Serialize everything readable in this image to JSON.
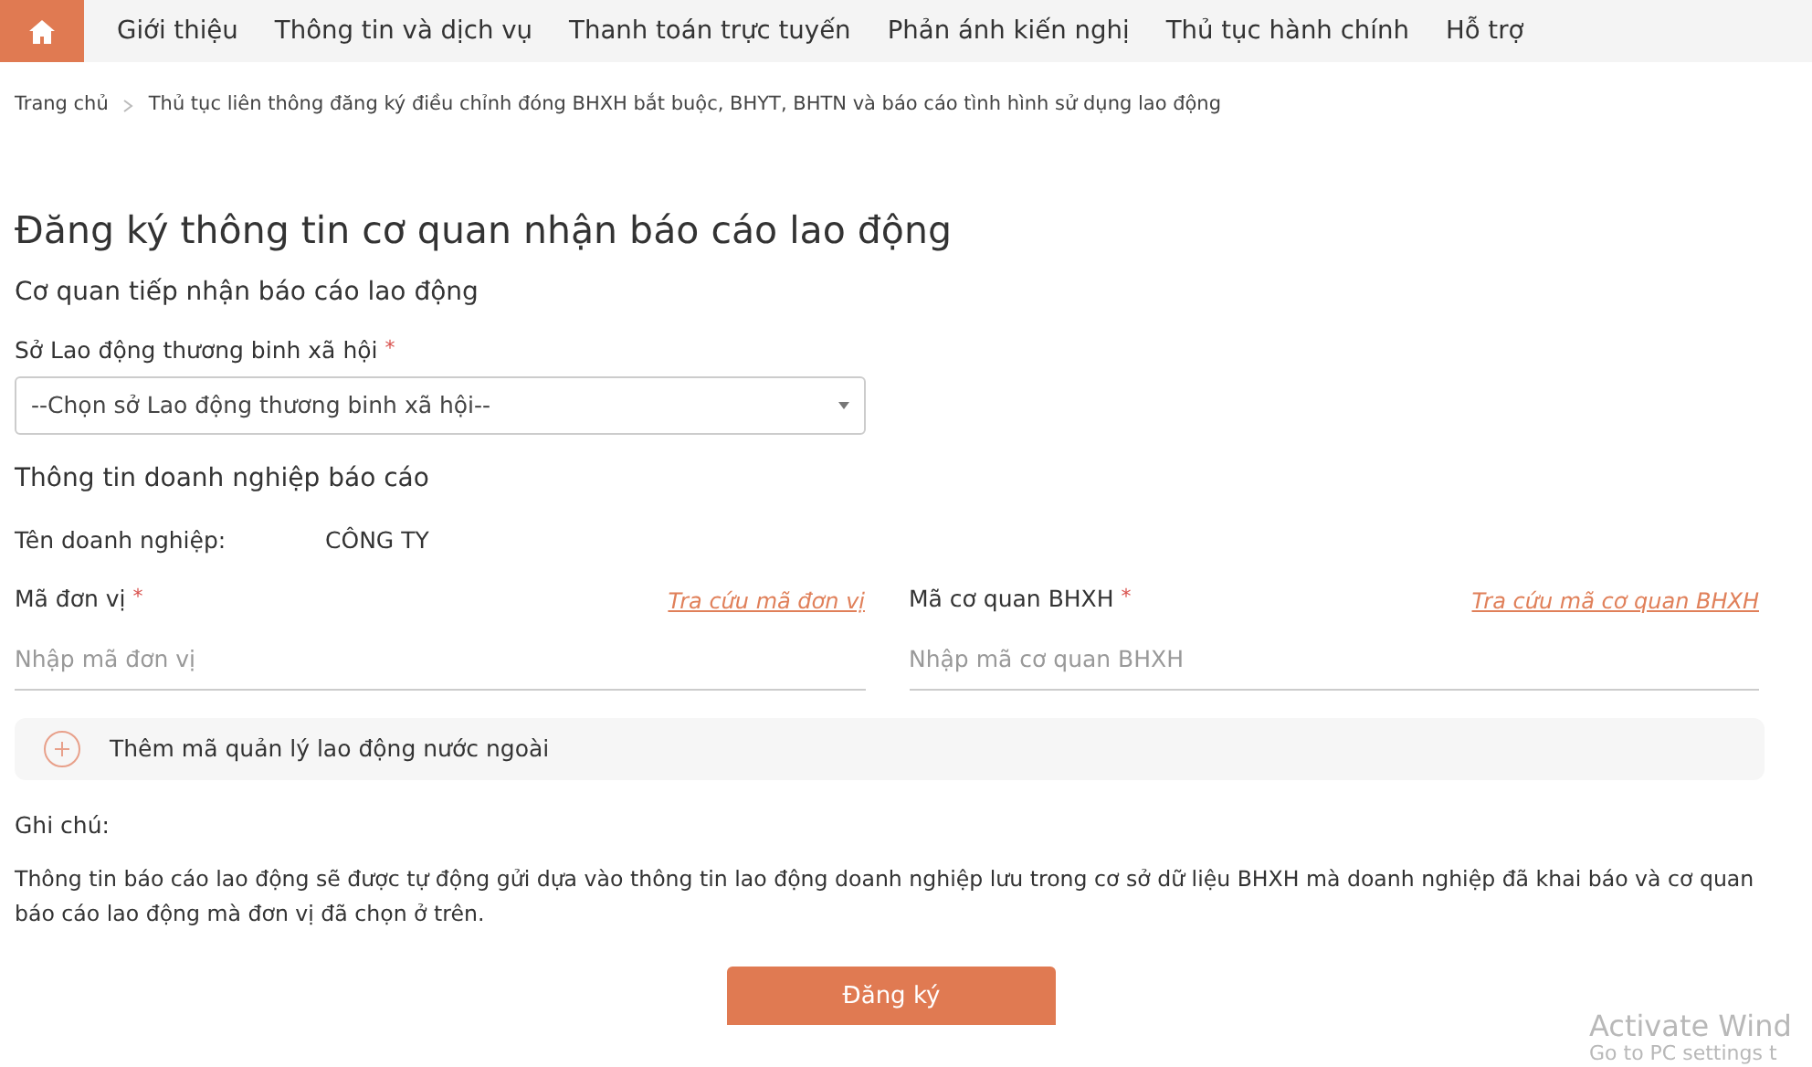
{
  "nav": {
    "items": [
      {
        "label": "Giới thiệu"
      },
      {
        "label": "Thông tin và dịch vụ"
      },
      {
        "label": "Thanh toán trực tuyến"
      },
      {
        "label": "Phản ánh kiến nghị"
      },
      {
        "label": "Thủ tục hành chính"
      },
      {
        "label": "Hỗ trợ"
      }
    ]
  },
  "breadcrumb": [
    {
      "label": "Trang chủ"
    },
    {
      "label": "Thủ tục liên thông đăng ký điều chỉnh đóng BHXH bắt buộc, BHYT, BHTN và báo cáo tình hình sử dụng lao động"
    }
  ],
  "page_title": "Đăng ký thông tin cơ quan nhận báo cáo lao động",
  "section_1": {
    "heading": "Cơ quan tiếp nhận báo cáo lao động",
    "select_label": "Sở Lao động thương binh xã hội",
    "required_mark": "*",
    "select_value": "--Chọn sở Lao động thương binh xã hội--"
  },
  "section_2": {
    "heading": "Thông tin doanh nghiệp báo cáo",
    "company_label": "Tên doanh nghiệp:",
    "company_value": "CÔNG TY",
    "fields": [
      {
        "label": "Mã đơn vị",
        "required_mark": "*",
        "link": "Tra cứu mã đơn vị",
        "placeholder": "Nhập mã đơn vị"
      },
      {
        "label": "Mã cơ quan BHXH",
        "required_mark": "*",
        "link": "Tra cứu mã cơ quan BHXH",
        "placeholder": "Nhập mã cơ quan BHXH"
      }
    ],
    "expander": {
      "label": "Thêm mã quản lý lao động nước ngoài",
      "expanded": false
    }
  },
  "note": {
    "label": "Ghi chú:",
    "text": "Thông tin báo cáo lao động sẽ được tự động gửi dựa vào thông tin lao động doanh nghiệp lưu trong cơ sở dữ liệu BHXH mà doanh nghiệp đã khai báo và cơ quan báo cáo lao động mà đơn vị đã chọn ở trên."
  },
  "submit_button": "Đăng ký",
  "os_notice": {
    "title": "Activate Wind",
    "subtitle": "Go to PC settings t"
  }
}
